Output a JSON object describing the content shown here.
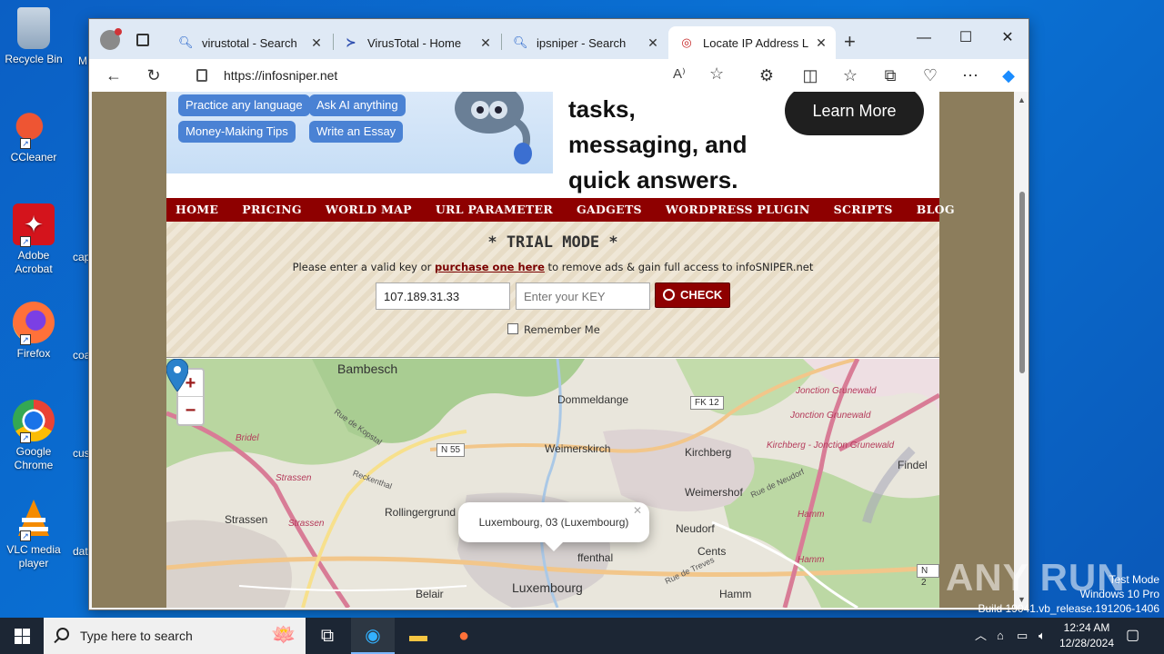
{
  "desktop": {
    "icons": [
      {
        "label": "Recycle Bin"
      },
      {
        "label": "CCleaner"
      },
      {
        "label": "Adobe Acrobat"
      },
      {
        "label": "Firefox"
      },
      {
        "label": "Google Chrome"
      },
      {
        "label": "VLC media player"
      }
    ],
    "partial_labels": [
      "M",
      "cap",
      "coa",
      "cus",
      "dat"
    ]
  },
  "browser": {
    "tabs": [
      {
        "title": "virustotal - Search",
        "icon": "search-icon"
      },
      {
        "title": "VirusTotal - Home",
        "icon": "virustotal-icon"
      },
      {
        "title": "ipsniper - Search",
        "icon": "search-icon"
      },
      {
        "title": "Locate IP Address Lool",
        "icon": "globe-icon",
        "active": true
      }
    ],
    "address": "https://infosniper.net"
  },
  "page": {
    "ad": {
      "pills": [
        "Practice any language",
        "Ask AI anything",
        "Money-Making Tips",
        "Write an Essay"
      ],
      "headline_lines": [
        "tasks,",
        "messaging, and",
        "quick answers."
      ],
      "cta": "Learn More"
    },
    "nav": [
      "HOME",
      "PRICING",
      "WORLD MAP",
      "URL PARAMETER",
      "GADGETS",
      "WORDPRESS PLUGIN",
      "SCRIPTS",
      "BLOG"
    ],
    "trial": {
      "title": "* TRIAL MODE *",
      "msg_before": "Please enter a valid key or ",
      "msg_link": "purchase one here",
      "msg_after": " to remove ads & gain full access to infoSNIPER.net",
      "ip_value": "107.189.31.33",
      "key_placeholder": "Enter your KEY",
      "check_label": "CHECK",
      "remember_label": "Remember Me"
    },
    "map": {
      "popup": "Luxembourg, 03 (Luxembourg)",
      "labels": {
        "bambesch": "Bambesch",
        "dommeldange": "Dommeldange",
        "weimerskirch": "Weimerskirch",
        "kirchberg": "Kirchberg",
        "weimershof": "Weimershof",
        "findel": "Findel",
        "rollingergrund": "Rollingergrund",
        "strassen": "Strassen",
        "strassen_pink": "Strassen",
        "strassen_pink2": "Strassen",
        "neudorf": "Neudorf",
        "cents": "Cents",
        "luxembourg": "Luxembourg",
        "belair": "Belair",
        "hamm": "Hamm",
        "hamm_pink": "Hamm",
        "hamm_pink2": "Hamm",
        "pfaffenthal": "ffenthal",
        "jonction1": "Jonction Grunewald",
        "jonction2": "Jonction Grunewald",
        "kirchberg_jonction": "Kirchberg - Jonction Grunewald",
        "bridel": "Bridel",
        "rue_kopstal": "Rue de Kopstal",
        "reckenthal": "Reckenthal",
        "rue_neudorf": "Rue de Neudorf",
        "rue_treves": "Rue de Treves",
        "n55": "N 55",
        "fk12": "FK 12",
        "n2": "N 2"
      }
    }
  },
  "overlay": {
    "watermark": "ANY RUN",
    "test_mode": "Test Mode",
    "os": "Windows 10 Pro",
    "build": "Build 19041.vb_release.191206-1406"
  },
  "taskbar": {
    "search_placeholder": "Type here to search",
    "time": "12:24 AM",
    "date": "12/28/2024"
  },
  "colors": {
    "nav_red": "#8e0000",
    "link_red": "#7a0000",
    "desktop_blue": "#0a63c9",
    "taskbar": "#1c2634",
    "marker_blue": "#2a81cb"
  }
}
